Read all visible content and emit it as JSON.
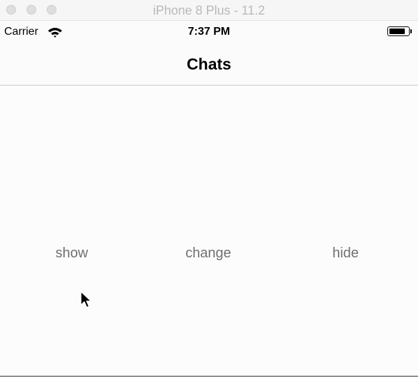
{
  "window": {
    "title": "iPhone 8 Plus - 11.2"
  },
  "status_bar": {
    "carrier": "Carrier",
    "time": "7:37 PM",
    "wifi_icon": "wifi-icon",
    "battery_icon": "battery-icon",
    "battery_level": 0.86
  },
  "navigation": {
    "title": "Chats"
  },
  "actions": {
    "show_label": "show",
    "change_label": "change",
    "hide_label": "hide"
  },
  "colors": {
    "button_text": "#6f6f6f",
    "nav_separator": "#c9c9cb",
    "title_gray": "#b9b9b9"
  }
}
